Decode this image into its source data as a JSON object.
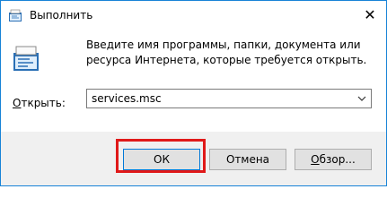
{
  "window": {
    "title": "Выполнить",
    "close_glyph": "✕"
  },
  "dialog": {
    "description": "Введите имя программы, папки, документа или ресурса Интернета, которые требуется открыть.",
    "open_label_underlined": "О",
    "open_label_rest": "ткрыть:",
    "command_value": "services.msc"
  },
  "buttons": {
    "ok": "ОК",
    "cancel": "Отмена",
    "browse_underlined": "О",
    "browse_rest": "бзор..."
  },
  "colors": {
    "window_border": "#1883d7",
    "highlight": "#e01919",
    "footer_bg": "#f0f0f0"
  },
  "icons": {
    "title": "run-icon",
    "dialog": "run-large-icon",
    "close": "close-icon",
    "dropdown": "chevron-down-icon"
  }
}
